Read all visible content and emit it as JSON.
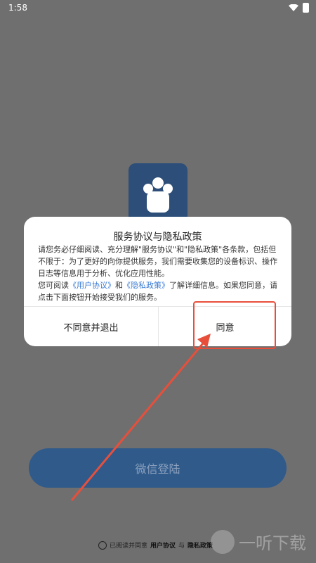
{
  "status": {
    "time": "1:58"
  },
  "dialog": {
    "title": "服务协议与隐私政策",
    "para1": "请您务必仔细阅读、充分理解\"服务协议\"和\"隐私政策\"各条款，包括但不限于：为了更好的向你提供服务，我们需要收集您的设备标识、操作日志等信息用于分析、优化应用性能。",
    "para2_prefix": "您可阅读",
    "link_user_agreement": "《用户协议》",
    "and": "和",
    "link_privacy_policy": "《隐私政策》",
    "para2_suffix": "了解详细信息。如果您同意，请点击下面按钮开始接受我们的服务。",
    "disagree_label": "不同意并退出",
    "agree_label": "同意"
  },
  "login": {
    "wechat_label": "微信登陆"
  },
  "footer": {
    "prefix": "已阅读并同意",
    "user_agreement": "用户协议",
    "and": "与",
    "privacy": "隐私政策"
  },
  "watermark": {
    "text": "一听下载"
  },
  "colors": {
    "accent": "#2f5a8a",
    "highlight": "#e84f3b",
    "link": "#3a7bd5"
  }
}
